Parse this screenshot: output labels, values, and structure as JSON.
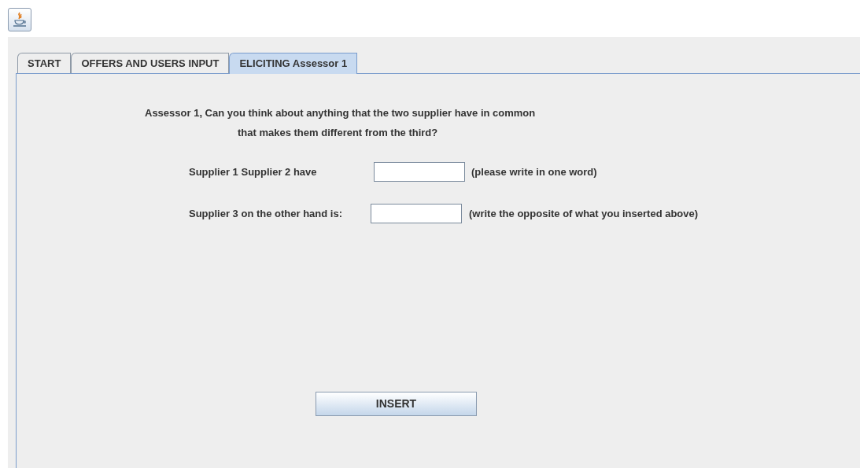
{
  "tabs": [
    {
      "label": "START",
      "selected": false
    },
    {
      "label": "OFFERS AND USERS INPUT",
      "selected": false
    },
    {
      "label": "ELICITING Assessor 1",
      "selected": true
    }
  ],
  "question": [
    "Assessor 1, Can you think about anything that the two supplier have in common",
    "that makes them different from the third?"
  ],
  "fields": [
    {
      "label": "Supplier 1 Supplier 2 have",
      "hint": "(please write in one word)"
    },
    {
      "label": "Supplier 3 on the other hand is:",
      "hint": "(write the opposite of what you inserted above)"
    }
  ],
  "button": "INSERT"
}
